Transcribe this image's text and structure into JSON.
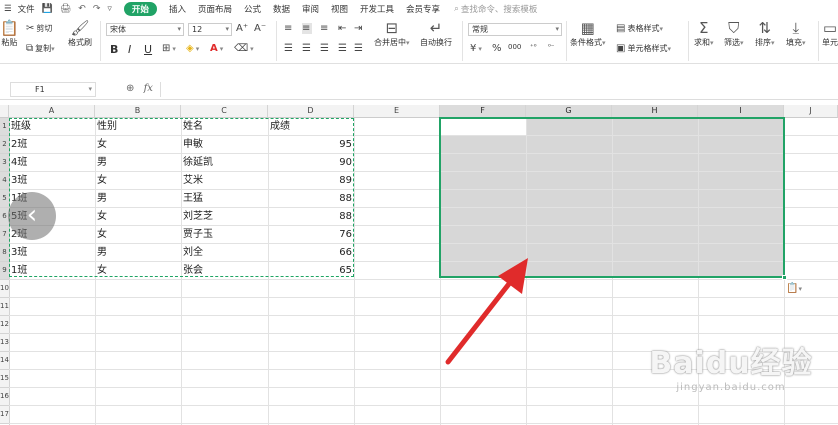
{
  "menu": {
    "file": "文件",
    "quick_icons": [
      "💾",
      "🖨",
      "↶",
      "↷",
      "▿"
    ],
    "tabs": [
      "开始",
      "插入",
      "页面布局",
      "公式",
      "数据",
      "审阅",
      "视图",
      "开发工具",
      "会员专享"
    ],
    "search": "查找命令、搜索模板"
  },
  "ribbon": {
    "paste": "粘贴",
    "cut": "剪切",
    "copy": "复制",
    "format_painter": "格式刷",
    "font_name": "宋体",
    "font_size": "12",
    "bold": "B",
    "italic": "I",
    "underline": "U",
    "font_color_glyph": "A",
    "merge_center": "合并居中",
    "wrap_text": "自动换行",
    "number_format": "常规",
    "currency": "¥",
    "percent": "%",
    "thousands": "000",
    "conditional_format": "条件格式",
    "table_style": "表格样式",
    "cell_style": "单元格样式",
    "sum": "求和",
    "filter": "筛选",
    "sort": "排序",
    "fill": "填充",
    "more": "单元"
  },
  "formula_bar": {
    "name_box": "F1",
    "fx": "fx",
    "value": ""
  },
  "columns": [
    "A",
    "B",
    "C",
    "D",
    "E",
    "F",
    "G",
    "H",
    "I",
    "J"
  ],
  "rows": [
    "1",
    "2",
    "3",
    "4",
    "5",
    "6",
    "7",
    "8",
    "9",
    "10",
    "11",
    "12",
    "13",
    "14",
    "15",
    "16",
    "17"
  ],
  "table": {
    "header": [
      "班级",
      "性别",
      "姓名",
      "成绩"
    ],
    "rows": [
      [
        "2班",
        "女",
        "申敏",
        "95"
      ],
      [
        "4班",
        "男",
        "徐延凯",
        "90"
      ],
      [
        "3班",
        "女",
        "艾米",
        "89"
      ],
      [
        "1班",
        "男",
        "王猛",
        "88"
      ],
      [
        "5班",
        "女",
        "刘芝芝",
        "88"
      ],
      [
        "2班",
        "女",
        "贾子玉",
        "76"
      ],
      [
        "3班",
        "男",
        "刘全",
        "66"
      ],
      [
        "1班",
        "女",
        "张会",
        "65"
      ]
    ]
  },
  "selection": {
    "range": "F1:I9",
    "active_cell": "F1"
  },
  "copy_range": "A1:D9",
  "watermark": {
    "logo": "Baidu经验",
    "url": "jingyan.baidu.com"
  },
  "colors": {
    "accent": "#21a366",
    "arrow": "#e02b2b",
    "selection_fill": "#d7d7d7"
  }
}
